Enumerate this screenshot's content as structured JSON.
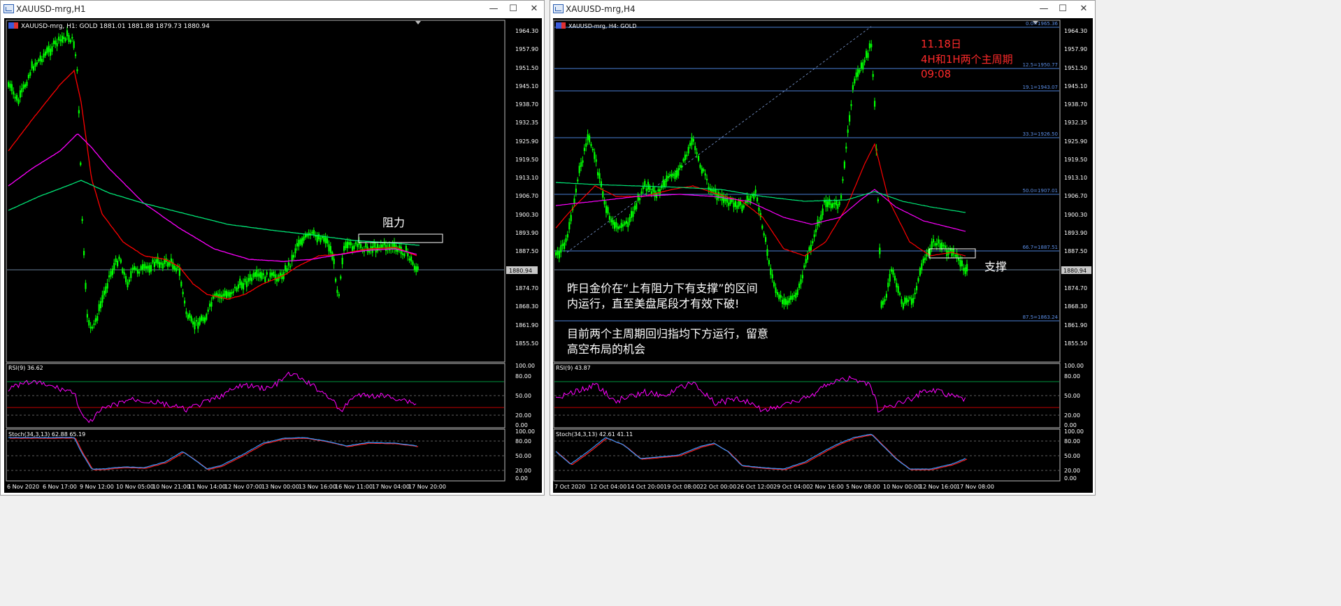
{
  "windows": [
    {
      "title": "XAUUSD-mrg,H1",
      "header": "XAUUSD-mrg, H1:  GOLD   1881.01  1881.88  1879.73  1880.94",
      "price_labels": [
        "1964.30",
        "1957.90",
        "1951.50",
        "1945.10",
        "1938.70",
        "1932.35",
        "1925.90",
        "1919.50",
        "1913.10",
        "1906.70",
        "1900.30",
        "1893.90",
        "1887.50",
        "1880.94",
        "1874.70",
        "1868.30",
        "1861.90",
        "1855.50"
      ],
      "current_price": "1880.94",
      "rsi_label": "RSI(9) 36.62",
      "rsi_scale": [
        "100.00",
        "80.00",
        "50.00",
        "20.00",
        "0.00"
      ],
      "stoch_label": "Stoch(34,3,13) 62.88 65.19",
      "stoch_scale": [
        "100.00",
        "80.00",
        "50.00",
        "20.00",
        "0.00"
      ],
      "time_labels": [
        "6 Nov 2020",
        "6 Nov 17:00",
        "9 Nov 12:00",
        "10 Nov 05:00",
        "10 Nov 21:00",
        "11 Nov 14:00",
        "12 Nov 07:00",
        "13 Nov 00:00",
        "13 Nov 16:00",
        "16 Nov 11:00",
        "17 Nov 04:00",
        "17 Nov 20:00"
      ],
      "annotation": "阻力"
    },
    {
      "title": "XAUUSD-mrg,H4",
      "header": "XAUUSD-mrg, H4:  GOLD",
      "price_labels": [
        "1964.30",
        "1957.90",
        "1951.50",
        "1945.10",
        "1938.70",
        "1932.35",
        "1925.90",
        "1919.50",
        "1913.10",
        "1906.70",
        "1900.30",
        "1893.90",
        "1887.50",
        "1880.94",
        "1874.70",
        "1868.30",
        "1861.90",
        "1855.50"
      ],
      "current_price": "1880.94",
      "fib_labels": [
        "0.0=1965.36",
        "12.5=1950.77",
        "19.1=1943.07",
        "33.3=1926.50",
        "50.0=1907.01",
        "66.7=1887.51",
        "87.5=1863.24"
      ],
      "rsi_label": "RSI(9) 43.87",
      "rsi_scale": [
        "100.00",
        "80.00",
        "50.00",
        "20.00",
        "0.00"
      ],
      "stoch_label": "Stoch(34,3,13) 42.61 41.11",
      "stoch_scale": [
        "100.00",
        "80.00",
        "50.00",
        "20.00",
        "0.00"
      ],
      "time_labels": [
        "7 Oct 2020",
        "12 Oct 04:00",
        "14 Oct 20:00",
        "19 Oct 08:00",
        "22 Oct 00:00",
        "26 Oct 12:00",
        "29 Oct 04:00",
        "2 Nov 16:00",
        "5 Nov 08:00",
        "10 Nov 00:00",
        "12 Nov 16:00",
        "17 Nov 08:00"
      ],
      "note_date": "11.18日",
      "note_title": "4H和1H两个主周期",
      "note_time": "09:08",
      "support": "支撑",
      "text1a": "昨日金价在“上有阻力下有支撑”的区间",
      "text1b": "内运行，直至美盘尾段才有效下破!",
      "text2a": "目前两个主周期回归指均下方运行，留意",
      "text2b": "高空布局的机会"
    }
  ],
  "window_buttons": {
    "minimize": "—",
    "maximize": "☐",
    "close": "✕"
  },
  "colors": {
    "candle": "#00ff00",
    "ma_red": "#ff0000",
    "ma_magenta": "#ff00ff",
    "ma_green": "#00e676",
    "fib": "#4a7fd6",
    "rsi": "#ff00ff",
    "stoch_main": "#3399ff",
    "stoch_signal": "#ff2020",
    "grid": "#bbbbbb",
    "price_line": "#6a7f9a",
    "note": "#ff2a2a"
  },
  "icons": [
    "window-app-icon",
    "minimize-icon",
    "maximize-icon",
    "close-icon",
    "chart-flag-icon",
    "scroll-marker-icon"
  ]
}
